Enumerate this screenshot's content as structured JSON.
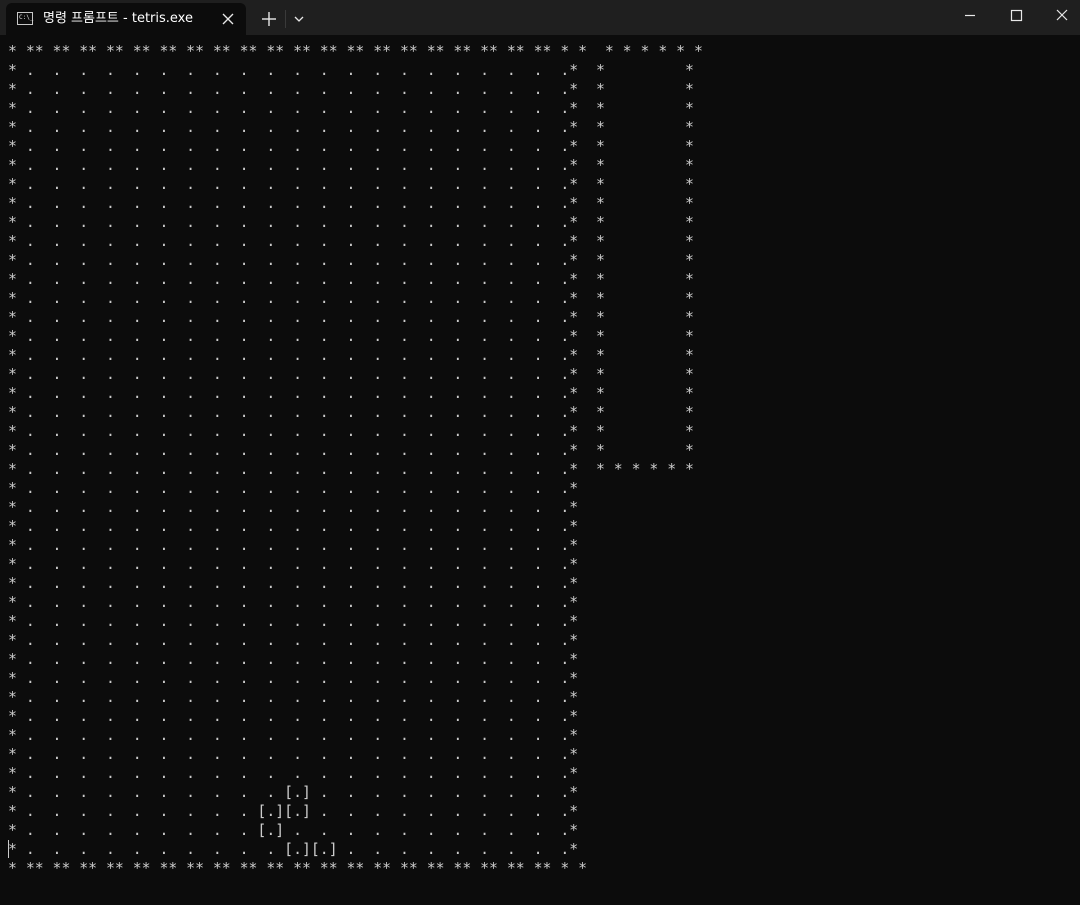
{
  "window": {
    "tab": {
      "title": "명령 프롬프트 - tetris.exe",
      "icon": "cmd-icon",
      "icon_text": "C:\\_"
    },
    "controls": {
      "new_tab_icon": "plus-icon",
      "dropdown_icon": "chevron-down-icon",
      "minimize_icon": "minimize-icon",
      "maximize_icon": "maximize-icon",
      "close_icon": "close-icon"
    }
  },
  "console": {
    "background": "#0c0c0c",
    "foreground": "#cccccc",
    "lines": [
      "* ** ** ** ** ** ** ** ** ** ** ** ** ** ** ** ** ** ** ** ** * *  * * * * * *",
      "* .  .  .  .  .  .  .  .  .  .  .  .  .  .  .  .  .  .  .  .  .*  *         *",
      "* .  .  .  .  .  .  .  .  .  .  .  .  .  .  .  .  .  .  .  .  .*  *         *",
      "* .  .  .  .  .  .  .  .  .  .  .  .  .  .  .  .  .  .  .  .  .*  *         *",
      "* .  .  .  .  .  .  .  .  .  .  .  .  .  .  .  .  .  .  .  .  .*  *         *",
      "* .  .  .  .  .  .  .  .  .  .  .  .  .  .  .  .  .  .  .  .  .*  *         *",
      "* .  .  .  .  .  .  .  .  .  .  .  .  .  .  .  .  .  .  .  .  .*  *         *",
      "* .  .  .  .  .  .  .  .  .  .  .  .  .  .  .  .  .  .  .  .  .*  *         *",
      "* .  .  .  .  .  .  .  .  .  .  .  .  .  .  .  .  .  .  .  .  .*  *         *",
      "* .  .  .  .  .  .  .  .  .  .  .  .  .  .  .  .  .  .  .  .  .*  *         *",
      "* .  .  .  .  .  .  .  .  .  .  .  .  .  .  .  .  .  .  .  .  .*  *         *",
      "* .  .  .  .  .  .  .  .  .  .  .  .  .  .  .  .  .  .  .  .  .*  *         *",
      "* .  .  .  .  .  .  .  .  .  .  .  .  .  .  .  .  .  .  .  .  .*  *         *",
      "* .  .  .  .  .  .  .  .  .  .  .  .  .  .  .  .  .  .  .  .  .*  *         *",
      "* .  .  .  .  .  .  .  .  .  .  .  .  .  .  .  .  .  .  .  .  .*  *         *",
      "* .  .  .  .  .  .  .  .  .  .  .  .  .  .  .  .  .  .  .  .  .*  *         *",
      "* .  .  .  .  .  .  .  .  .  .  .  .  .  .  .  .  .  .  .  .  .*  *         *",
      "* .  .  .  .  .  .  .  .  .  .  .  .  .  .  .  .  .  .  .  .  .*  *         *",
      "* .  .  .  .  .  .  .  .  .  .  .  .  .  .  .  .  .  .  .  .  .*  *         *",
      "* .  .  .  .  .  .  .  .  .  .  .  .  .  .  .  .  .  .  .  .  .*  *         *",
      "* .  .  .  .  .  .  .  .  .  .  .  .  .  .  .  .  .  .  .  .  .*  *         *",
      "* .  .  .  .  .  .  .  .  .  .  .  .  .  .  .  .  .  .  .  .  .*  *         *",
      "* .  .  .  .  .  .  .  .  .  .  .  .  .  .  .  .  .  .  .  .  .*  * * * * * *",
      "* .  .  .  .  .  .  .  .  .  .  .  .  .  .  .  .  .  .  .  .  .*",
      "* .  .  .  .  .  .  .  .  .  .  .  .  .  .  .  .  .  .  .  .  .*",
      "* .  .  .  .  .  .  .  .  .  .  .  .  .  .  .  .  .  .  .  .  .*",
      "* .  .  .  .  .  .  .  .  .  .  .  .  .  .  .  .  .  .  .  .  .*",
      "* .  .  .  .  .  .  .  .  .  .  .  .  .  .  .  .  .  .  .  .  .*",
      "* .  .  .  .  .  .  .  .  .  .  .  .  .  .  .  .  .  .  .  .  .*",
      "* .  .  .  .  .  .  .  .  .  .  .  .  .  .  .  .  .  .  .  .  .*",
      "* .  .  .  .  .  .  .  .  .  .  .  .  .  .  .  .  .  .  .  .  .*",
      "* .  .  .  .  .  .  .  .  .  .  .  .  .  .  .  .  .  .  .  .  .*",
      "* .  .  .  .  .  .  .  .  .  .  .  .  .  .  .  .  .  .  .  .  .*",
      "* .  .  .  .  .  .  .  .  .  .  .  .  .  .  .  .  .  .  .  .  .*",
      "* .  .  .  .  .  .  .  .  .  .  .  .  .  .  .  .  .  .  .  .  .*",
      "* .  .  .  .  .  .  .  .  .  .  .  .  .  .  .  .  .  .  .  .  .*",
      "* .  .  .  .  .  .  .  .  .  .  .  .  .  .  .  .  .  .  .  .  .*",
      "* .  .  .  .  .  .  .  .  .  .  .  .  .  .  .  .  .  .  .  .  .*",
      "* .  .  .  .  .  .  .  .  .  .  .  .  .  .  .  .  .  .  .  .  .*",
      "* .  .  .  .  .  .  .  .  .  . [.] .  .  .  .  .  .  .  .  .  .*",
      "* .  .  .  .  .  .  .  .  . [.][.] .  .  .  .  .  .  .  .  .  .*",
      "* .  .  .  .  .  .  .  .  . [.] .  .  .  .  .  .  .  .  .  .  .*",
      "* .  .  .  .  .  .  .  .  .  . [.][.] .  .  .  .  .  .  .  .  .*",
      "* ** ** ** ** ** ** ** ** ** ** ** ** ** ** ** ** ** ** ** ** * *"
    ]
  }
}
